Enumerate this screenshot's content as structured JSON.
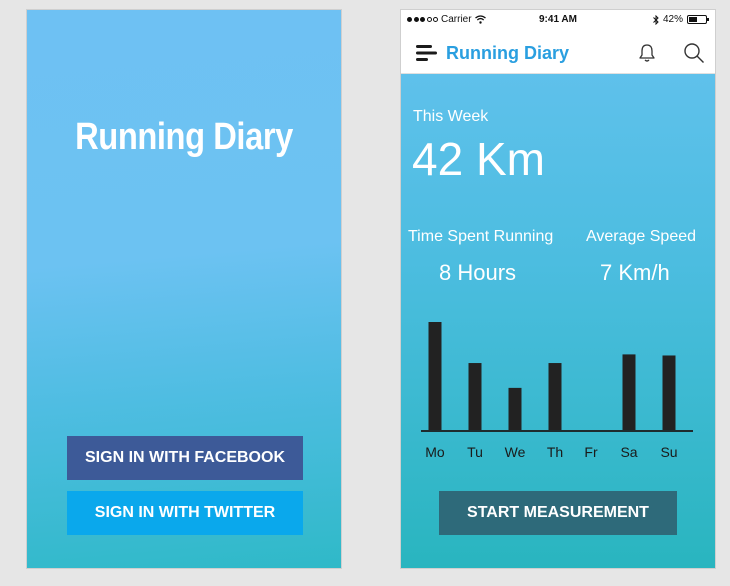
{
  "login": {
    "app_title": "Running Diary",
    "facebook_button": "SIGN IN WITH FACEBOOK",
    "twitter_button": "SIGN IN WITH TWITTER",
    "colors": {
      "facebook": "#3d5a98",
      "twitter": "#0aa8ec"
    }
  },
  "dashboard": {
    "status_bar": {
      "carrier": "Carrier",
      "time": "9:41 AM",
      "battery": "42%"
    },
    "nav": {
      "title": "Running Diary",
      "icons": [
        "menu-icon",
        "bell-icon",
        "search-icon"
      ]
    },
    "week": {
      "label": "This Week",
      "value": "42 Km"
    },
    "stats": {
      "time_label": "Time Spent Running",
      "time_value": "8 Hours",
      "speed_label": "Average Speed",
      "speed_value": "7 Km/h"
    },
    "start_button": "START MEASUREMENT",
    "colors": {
      "accent": "#2a9fe0",
      "start_button": "#2e6a7a",
      "bars": "#222222"
    }
  },
  "chart_data": {
    "type": "bar",
    "categories": [
      "Mo",
      "Tu",
      "We",
      "Th",
      "Fr",
      "Sa",
      "Su"
    ],
    "values": [
      100,
      62,
      39,
      62,
      0,
      70,
      69
    ],
    "title": "",
    "xlabel": "",
    "ylabel": "",
    "ylim": [
      0,
      100
    ],
    "grid": false,
    "y_axis_labels": false
  }
}
